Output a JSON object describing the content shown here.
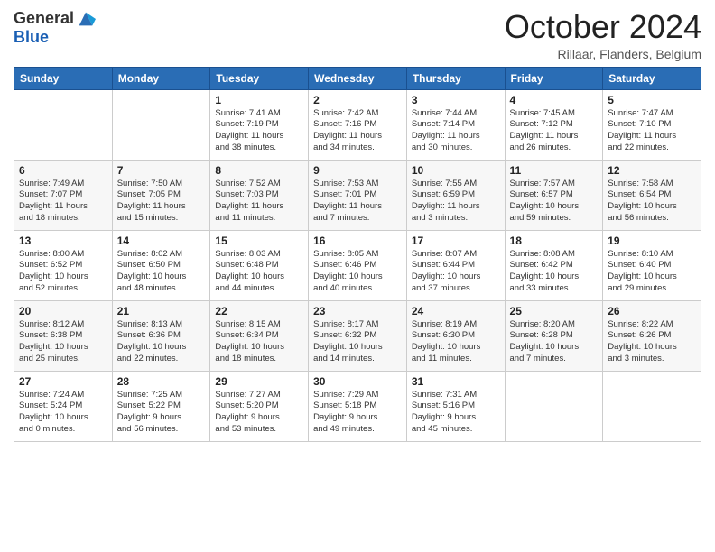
{
  "header": {
    "logo_general": "General",
    "logo_blue": "Blue",
    "month_title": "October 2024",
    "location": "Rillaar, Flanders, Belgium"
  },
  "days_of_week": [
    "Sunday",
    "Monday",
    "Tuesday",
    "Wednesday",
    "Thursday",
    "Friday",
    "Saturday"
  ],
  "weeks": [
    [
      {
        "day": "",
        "info": ""
      },
      {
        "day": "",
        "info": ""
      },
      {
        "day": "1",
        "info": "Sunrise: 7:41 AM\nSunset: 7:19 PM\nDaylight: 11 hours\nand 38 minutes."
      },
      {
        "day": "2",
        "info": "Sunrise: 7:42 AM\nSunset: 7:16 PM\nDaylight: 11 hours\nand 34 minutes."
      },
      {
        "day": "3",
        "info": "Sunrise: 7:44 AM\nSunset: 7:14 PM\nDaylight: 11 hours\nand 30 minutes."
      },
      {
        "day": "4",
        "info": "Sunrise: 7:45 AM\nSunset: 7:12 PM\nDaylight: 11 hours\nand 26 minutes."
      },
      {
        "day": "5",
        "info": "Sunrise: 7:47 AM\nSunset: 7:10 PM\nDaylight: 11 hours\nand 22 minutes."
      }
    ],
    [
      {
        "day": "6",
        "info": "Sunrise: 7:49 AM\nSunset: 7:07 PM\nDaylight: 11 hours\nand 18 minutes."
      },
      {
        "day": "7",
        "info": "Sunrise: 7:50 AM\nSunset: 7:05 PM\nDaylight: 11 hours\nand 15 minutes."
      },
      {
        "day": "8",
        "info": "Sunrise: 7:52 AM\nSunset: 7:03 PM\nDaylight: 11 hours\nand 11 minutes."
      },
      {
        "day": "9",
        "info": "Sunrise: 7:53 AM\nSunset: 7:01 PM\nDaylight: 11 hours\nand 7 minutes."
      },
      {
        "day": "10",
        "info": "Sunrise: 7:55 AM\nSunset: 6:59 PM\nDaylight: 11 hours\nand 3 minutes."
      },
      {
        "day": "11",
        "info": "Sunrise: 7:57 AM\nSunset: 6:57 PM\nDaylight: 10 hours\nand 59 minutes."
      },
      {
        "day": "12",
        "info": "Sunrise: 7:58 AM\nSunset: 6:54 PM\nDaylight: 10 hours\nand 56 minutes."
      }
    ],
    [
      {
        "day": "13",
        "info": "Sunrise: 8:00 AM\nSunset: 6:52 PM\nDaylight: 10 hours\nand 52 minutes."
      },
      {
        "day": "14",
        "info": "Sunrise: 8:02 AM\nSunset: 6:50 PM\nDaylight: 10 hours\nand 48 minutes."
      },
      {
        "day": "15",
        "info": "Sunrise: 8:03 AM\nSunset: 6:48 PM\nDaylight: 10 hours\nand 44 minutes."
      },
      {
        "day": "16",
        "info": "Sunrise: 8:05 AM\nSunset: 6:46 PM\nDaylight: 10 hours\nand 40 minutes."
      },
      {
        "day": "17",
        "info": "Sunrise: 8:07 AM\nSunset: 6:44 PM\nDaylight: 10 hours\nand 37 minutes."
      },
      {
        "day": "18",
        "info": "Sunrise: 8:08 AM\nSunset: 6:42 PM\nDaylight: 10 hours\nand 33 minutes."
      },
      {
        "day": "19",
        "info": "Sunrise: 8:10 AM\nSunset: 6:40 PM\nDaylight: 10 hours\nand 29 minutes."
      }
    ],
    [
      {
        "day": "20",
        "info": "Sunrise: 8:12 AM\nSunset: 6:38 PM\nDaylight: 10 hours\nand 25 minutes."
      },
      {
        "day": "21",
        "info": "Sunrise: 8:13 AM\nSunset: 6:36 PM\nDaylight: 10 hours\nand 22 minutes."
      },
      {
        "day": "22",
        "info": "Sunrise: 8:15 AM\nSunset: 6:34 PM\nDaylight: 10 hours\nand 18 minutes."
      },
      {
        "day": "23",
        "info": "Sunrise: 8:17 AM\nSunset: 6:32 PM\nDaylight: 10 hours\nand 14 minutes."
      },
      {
        "day": "24",
        "info": "Sunrise: 8:19 AM\nSunset: 6:30 PM\nDaylight: 10 hours\nand 11 minutes."
      },
      {
        "day": "25",
        "info": "Sunrise: 8:20 AM\nSunset: 6:28 PM\nDaylight: 10 hours\nand 7 minutes."
      },
      {
        "day": "26",
        "info": "Sunrise: 8:22 AM\nSunset: 6:26 PM\nDaylight: 10 hours\nand 3 minutes."
      }
    ],
    [
      {
        "day": "27",
        "info": "Sunrise: 7:24 AM\nSunset: 5:24 PM\nDaylight: 10 hours\nand 0 minutes."
      },
      {
        "day": "28",
        "info": "Sunrise: 7:25 AM\nSunset: 5:22 PM\nDaylight: 9 hours\nand 56 minutes."
      },
      {
        "day": "29",
        "info": "Sunrise: 7:27 AM\nSunset: 5:20 PM\nDaylight: 9 hours\nand 53 minutes."
      },
      {
        "day": "30",
        "info": "Sunrise: 7:29 AM\nSunset: 5:18 PM\nDaylight: 9 hours\nand 49 minutes."
      },
      {
        "day": "31",
        "info": "Sunrise: 7:31 AM\nSunset: 5:16 PM\nDaylight: 9 hours\nand 45 minutes."
      },
      {
        "day": "",
        "info": ""
      },
      {
        "day": "",
        "info": ""
      }
    ]
  ]
}
